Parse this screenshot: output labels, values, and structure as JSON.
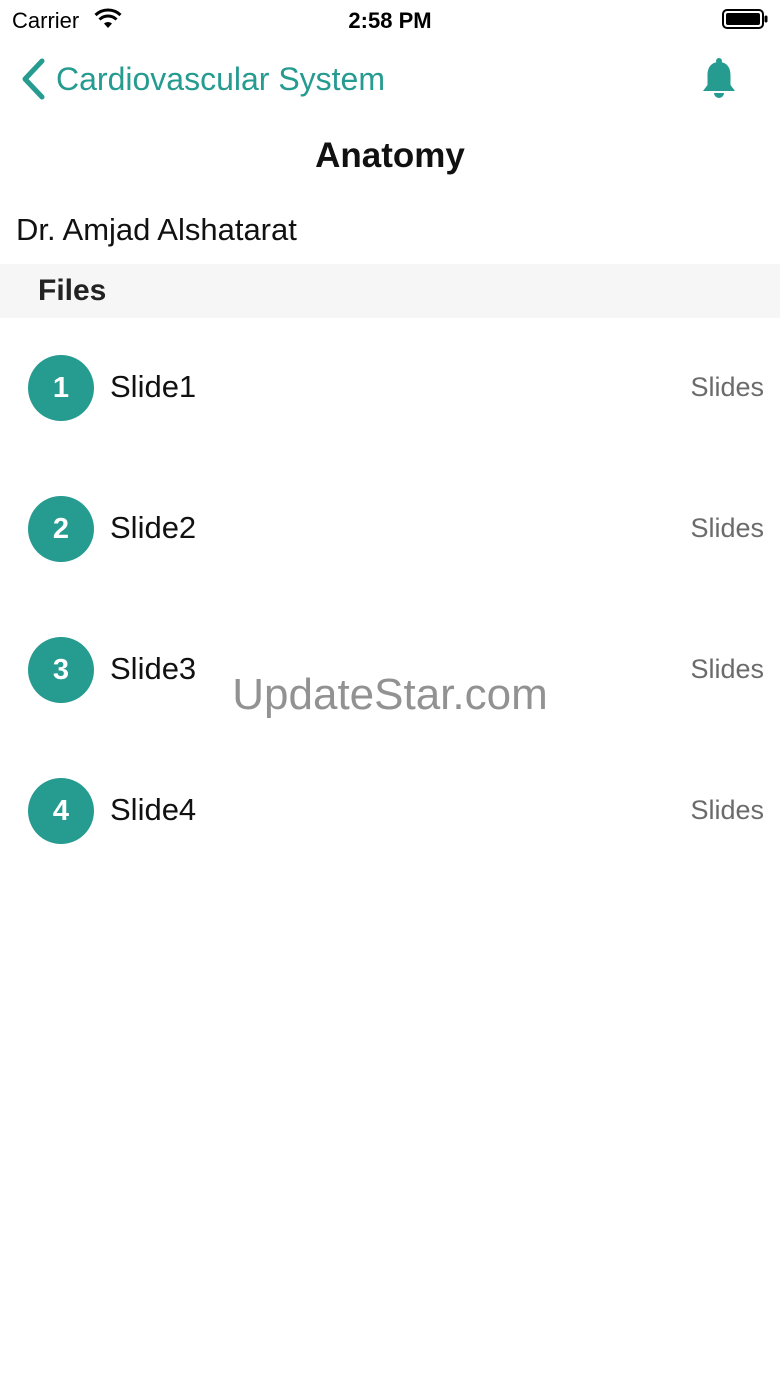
{
  "status_bar": {
    "carrier": "Carrier",
    "time": "2:58 PM"
  },
  "nav": {
    "back_label": "Cardiovascular System",
    "accent_color": "#269b90"
  },
  "page": {
    "title": "Anatomy",
    "instructor": "Dr. Amjad Alshatarat"
  },
  "section": {
    "title": "Files"
  },
  "files": [
    {
      "number": "1",
      "name": "Slide1",
      "type": "Slides"
    },
    {
      "number": "2",
      "name": "Slide2",
      "type": "Slides"
    },
    {
      "number": "3",
      "name": "Slide3",
      "type": "Slides"
    },
    {
      "number": "4",
      "name": "Slide4",
      "type": "Slides"
    }
  ],
  "watermark": "UpdateStar.com",
  "icons": {
    "back": "chevron-left-icon",
    "notifications": "bell-icon",
    "wifi": "wifi-icon",
    "battery": "battery-icon"
  }
}
